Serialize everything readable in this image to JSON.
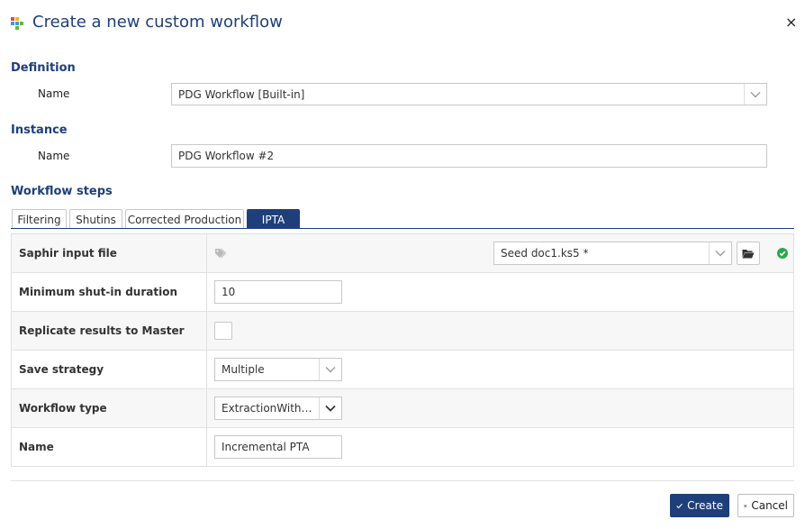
{
  "dialog": {
    "title": "Create a new custom workflow",
    "close_icon": "×"
  },
  "definition": {
    "heading": "Definition",
    "name_label": "Name",
    "name_value": "PDG Workflow [Built-in]"
  },
  "instance": {
    "heading": "Instance",
    "name_label": "Name",
    "name_value": "PDG Workflow #2"
  },
  "steps": {
    "heading": "Workflow steps",
    "tabs": [
      {
        "label": "Filtering"
      },
      {
        "label": "Shutins"
      },
      {
        "label": "Corrected Production"
      },
      {
        "label": "IPTA"
      }
    ],
    "active_tab": "IPTA"
  },
  "ipta": {
    "saphir_label": "Saphir input file",
    "saphir_value": "Seed doc1.ks5 *",
    "min_shutin_label": "Minimum shut-in duration",
    "min_shutin_value": "10",
    "replicate_label": "Replicate results to Master",
    "replicate_checked": false,
    "save_strategy_label": "Save strategy",
    "save_strategy_value": "Multiple",
    "workflow_type_label": "Workflow type",
    "workflow_type_value": "ExtractionWithM...",
    "name_label": "Name",
    "name_value": "Incremental PTA"
  },
  "footer": {
    "create_label": "Create",
    "cancel_label": "Cancel"
  },
  "colors": {
    "accent": "#1f3f7a",
    "success": "#2aa84a",
    "icon_gray": "#b9b9b9"
  }
}
